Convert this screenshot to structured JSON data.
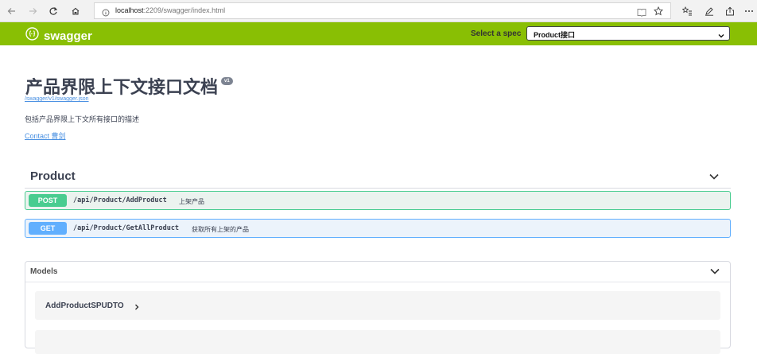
{
  "browser": {
    "url_host": "localhost",
    "url_rest": ":2209/swagger/index.html"
  },
  "topbar": {
    "brand": "swagger",
    "spec_label": "Select a spec",
    "spec_value": "Product接口"
  },
  "info": {
    "title": "产品界限上下文接口文档",
    "version": "v1",
    "spec_url": "/swagger/v1/swagger.json",
    "description": "包括产品界限上下文所有接口的描述",
    "contact": "Contact 曹剑"
  },
  "tag": {
    "name": "Product"
  },
  "operations": [
    {
      "method": "POST",
      "path": "/api/Product/AddProduct",
      "summary": "上架产品"
    },
    {
      "method": "GET",
      "path": "/api/Product/GetAllProduct",
      "summary": "获取所有上架的产品"
    }
  ],
  "models": {
    "title": "Models",
    "items": [
      {
        "name": "AddProductSPUDTO"
      }
    ]
  }
}
